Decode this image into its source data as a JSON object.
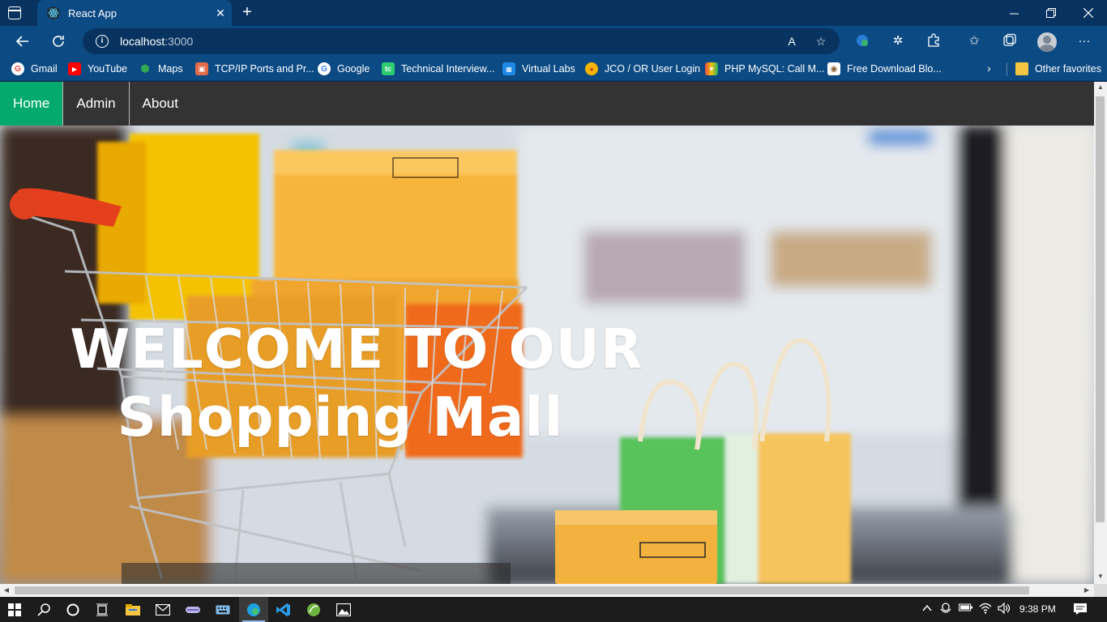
{
  "browser": {
    "tab_title": "React App",
    "tab_close": "✕",
    "new_tab": "+",
    "url_host": "localhost",
    "url_port": ":3000",
    "window_controls": [
      "minimize-icon",
      "restore-icon",
      "close-icon"
    ]
  },
  "favorites": [
    {
      "label": "Gmail",
      "icon": "G",
      "color": "#ffffff",
      "icon_color": "#ea4335"
    },
    {
      "label": "YouTube",
      "icon": "▶",
      "color": "#ff0000",
      "icon_color": "#ffffff"
    },
    {
      "label": "Maps",
      "icon": "●",
      "color": "#34a853",
      "icon_color": "#fbbc04"
    },
    {
      "label": "TCP/IP Ports and Pr...",
      "icon": "■",
      "color": "#e26b4a",
      "icon_color": "#ffffff"
    },
    {
      "label": "Google",
      "icon": "G",
      "color": "#ffffff",
      "icon_color": "#4285f4"
    },
    {
      "label": "Technical Interview...",
      "icon": "tc",
      "color": "#2ecc71",
      "icon_color": "#ffffff"
    },
    {
      "label": "Virtual Labs",
      "icon": "■",
      "color": "#1e88e5",
      "icon_color": "#ffffff"
    },
    {
      "label": "JCO / OR User Login",
      "icon": "●",
      "color": "#f5b400",
      "icon_color": "#c0392b"
    },
    {
      "label": "PHP MySQL: Call M...",
      "icon": "▲",
      "color": "#e74c3c",
      "icon_color": "#27ae60"
    },
    {
      "label": "Free Download Blo...",
      "icon": "●",
      "color": "#ffffff",
      "icon_color": "#8b5a2b"
    }
  ],
  "favorites_more": "›",
  "other_favorites": "Other favorites",
  "nav": {
    "items": [
      "Home",
      "Admin",
      "About"
    ],
    "active_color": "#04aa6d",
    "bar_color": "#333333"
  },
  "hero": {
    "line1": "WELCOME TO OUR",
    "line2": "Shopping Mall"
  },
  "taskbar": {
    "time": "9:38 PM"
  }
}
